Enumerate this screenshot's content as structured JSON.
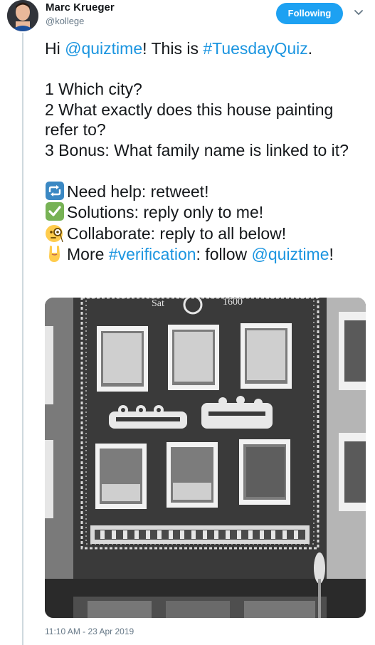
{
  "author": {
    "display_name": "Marc Krueger",
    "handle": "@kollege"
  },
  "follow_button": {
    "label": "Following",
    "color": "#1da1f2"
  },
  "tweet": {
    "greeting_prefix": "Hi ",
    "mention_quiztime": "@quiztime",
    "greeting_mid": "! This is ",
    "hashtag": "#TuesdayQuiz",
    "greeting_end": ".",
    "q1": "1 Which city?",
    "q2": "2 What exactly does this house painting refer to?",
    "q3": "3 Bonus: What family name is linked to it?",
    "help": "Need help: retweet!",
    "solutions": "Solutions: reply only to me!",
    "collab": "Collaborate: reply to all below!",
    "more_prefix": "More ",
    "verification_tag": "#verification",
    "more_mid": ": follow ",
    "mention_end": "@quiztime",
    "more_end": "!"
  },
  "emojis": {
    "retweet": "retweet-icon",
    "check": "check-mark-icon",
    "monocle": "monocle-face-icon",
    "horns": "sign-of-horns-icon"
  },
  "media": {
    "subject": "black-and-white photo of a building facade with sgraffito house painting"
  },
  "timestamp": "11:10 AM - 23 Apr 2019",
  "colors": {
    "link": "#1b95e0",
    "secondary_text": "#657786"
  }
}
